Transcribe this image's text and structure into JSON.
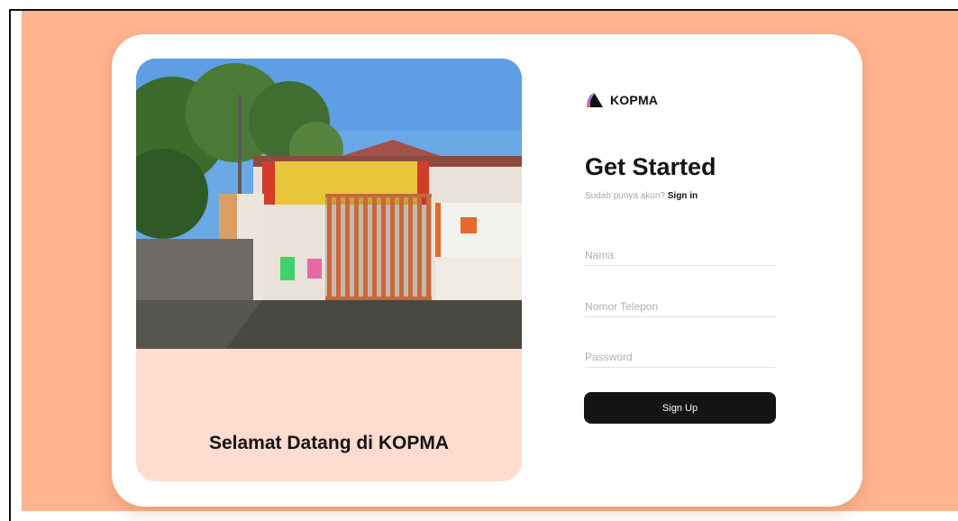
{
  "brand": {
    "name": "KOPMA",
    "logo_icon": "kopma-logo-icon"
  },
  "carousel": {
    "caption": "Selamat Datang di KOPMA",
    "slides_count": 3,
    "active_slide": 1,
    "photo_icon": "storefront-photo"
  },
  "form": {
    "title": "Get Started",
    "subtitle_prefix": "Sudah punya akun?",
    "signin_label": "Sign in",
    "fields": {
      "nama_placeholder": "Nama",
      "telepon_placeholder": "Nomor Telepon",
      "password_placeholder": "Password"
    },
    "submit_label": "Sign Up"
  },
  "colors": {
    "background": "#ffb48f",
    "panel": "#fedcd0",
    "button": "#161313"
  }
}
